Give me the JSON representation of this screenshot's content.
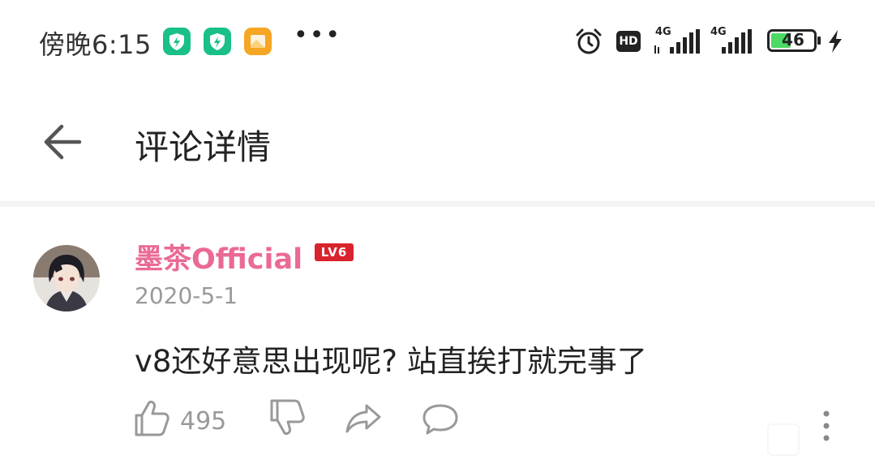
{
  "status_bar": {
    "time": "傍晚6:15",
    "more_glyph": "•••",
    "net1": "4G",
    "net2": "4G",
    "hd": "HD",
    "battery": "46",
    "icons": [
      "shield-app-icon",
      "shield-app-icon",
      "gallery-app-icon",
      "alarm-icon",
      "hd-icon",
      "signal-icon",
      "signal-icon",
      "battery-icon",
      "charging-icon"
    ]
  },
  "header": {
    "title": "评论详情",
    "back_icon": "arrow-left-icon"
  },
  "comment": {
    "username": "墨茶Official",
    "level": "LV6",
    "date": "2020-5-1",
    "text": "v8还好意思出现呢? 站直挨打就完事了",
    "likes": "495",
    "actions": [
      "thumb-up-icon",
      "thumb-down-icon",
      "share-icon",
      "reply-icon",
      "more-icon"
    ]
  },
  "colors": {
    "username": "#ea6a95",
    "level_badge": "#d9232d",
    "app_green": "#19c087",
    "app_orange": "#f6a623",
    "battery_fill": "#4cd964"
  }
}
